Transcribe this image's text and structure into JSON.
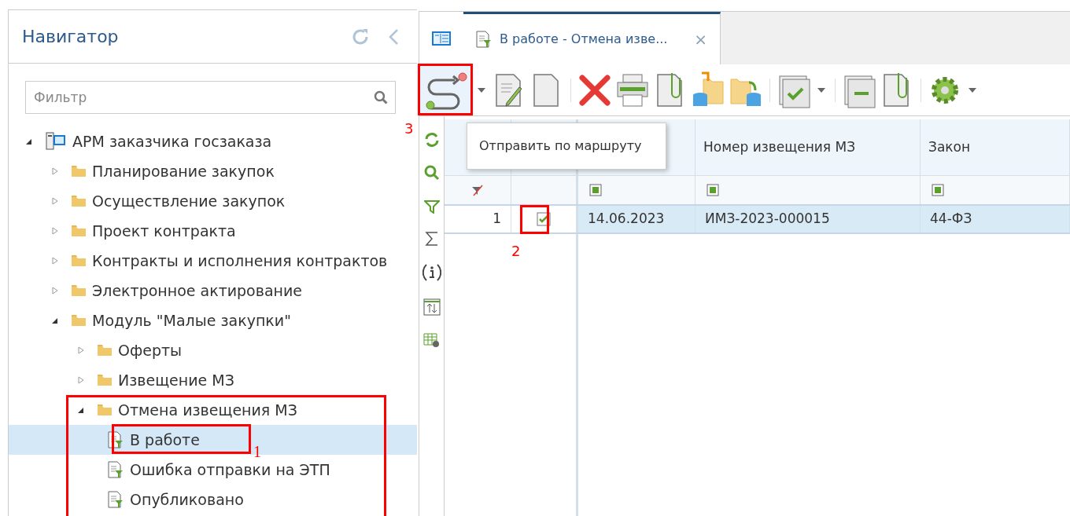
{
  "navigator": {
    "title": "Навигатор",
    "filter": {
      "placeholder": "Фильтр"
    },
    "tree": [
      {
        "label": "АРМ заказчика госзаказа",
        "kind": "root",
        "expanded": true,
        "selected": false,
        "children": [
          {
            "label": "Планирование закупок",
            "kind": "folder",
            "expanded": false,
            "selected": false
          },
          {
            "label": "Осуществление закупок",
            "kind": "folder",
            "expanded": false,
            "selected": false
          },
          {
            "label": "Проект контракта",
            "kind": "folder",
            "expanded": false,
            "selected": false
          },
          {
            "label": "Контракты и исполнения контрактов",
            "kind": "folder",
            "expanded": false,
            "selected": false
          },
          {
            "label": "Электронное актирование",
            "kind": "folder",
            "expanded": false,
            "selected": false
          },
          {
            "label": "Модуль \"Малые закупки\"",
            "kind": "folder",
            "expanded": true,
            "selected": false,
            "children": [
              {
                "label": "Оферты",
                "kind": "folder",
                "expanded": false,
                "selected": false
              },
              {
                "label": "Извещение МЗ",
                "kind": "folder",
                "expanded": false,
                "selected": false
              },
              {
                "label": "Отмена извещения МЗ",
                "kind": "folder",
                "expanded": true,
                "selected": false,
                "children": [
                  {
                    "label": "В работе",
                    "kind": "doc",
                    "selected": true
                  },
                  {
                    "label": "Ошибка отправки на ЭТП",
                    "kind": "doc",
                    "selected": false
                  },
                  {
                    "label": "Опубликовано",
                    "kind": "doc",
                    "selected": false
                  }
                ]
              }
            ]
          }
        ]
      }
    ]
  },
  "tabs": [
    {
      "label": "В работе - Отмена изве...",
      "selected": true,
      "close": "×"
    }
  ],
  "tooltip": "Отправить по маршруту",
  "table": {
    "columns": [
      {},
      {
        "label": "Номер извещения МЗ"
      },
      {
        "label": "Закон"
      }
    ],
    "rows": [
      {
        "number": "1",
        "checked": true,
        "selected": true,
        "cells": [
          "14.06.2023",
          "ИМЗ-2023-000015",
          "44-ФЗ"
        ]
      }
    ]
  },
  "annotations": [
    "1",
    "2",
    "3"
  ]
}
